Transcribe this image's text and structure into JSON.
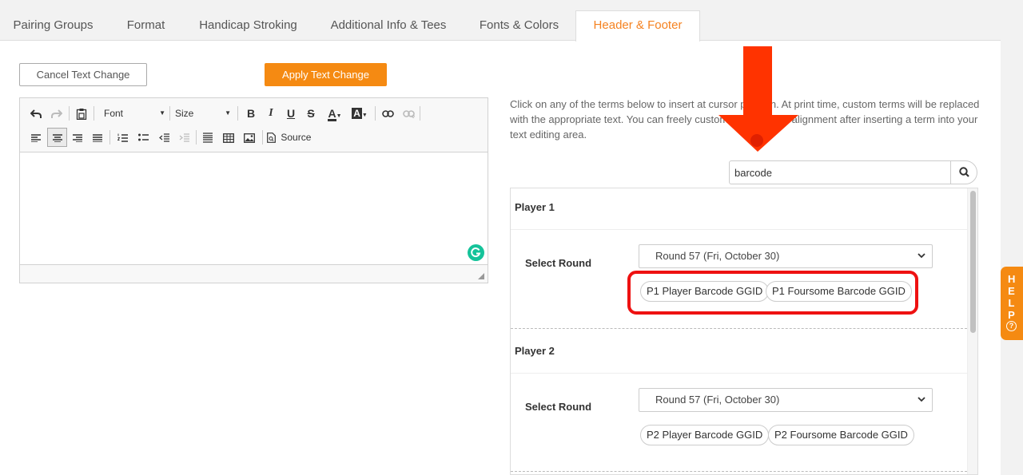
{
  "tabs": [
    {
      "label": "Pairing Groups"
    },
    {
      "label": "Format"
    },
    {
      "label": "Handicap Stroking"
    },
    {
      "label": "Additional Info & Tees"
    },
    {
      "label": "Fonts & Colors"
    },
    {
      "label": "Header & Footer",
      "active": true
    }
  ],
  "buttons": {
    "cancel_label": "Cancel Text Change",
    "apply_label": "Apply Text Change"
  },
  "toolbar": {
    "font_label": "Font",
    "size_label": "Size",
    "source_label": "Source"
  },
  "instructions": "Click on any of the terms below to insert at cursor position. At print time, custom terms will be replaced with the appropriate text. You can freely customize font, size, alignment after inserting a term into your text editing area.",
  "search": {
    "value": "barcode"
  },
  "players": [
    {
      "title": "Player 1",
      "select_label": "Select Round",
      "round_value": "Round 57 (Fri, October 30)",
      "chips": [
        "P1 Player Barcode GGID",
        "P1 Foursome Barcode GGID"
      ]
    },
    {
      "title": "Player 2",
      "select_label": "Select Round",
      "round_value": "Round 57 (Fri, October 30)",
      "chips": [
        "P2 Player Barcode GGID",
        "P2 Foursome Barcode GGID"
      ]
    }
  ],
  "help": {
    "label": "HELP",
    "question_mark": "?"
  },
  "colors": {
    "accent": "#f58a12",
    "active_tab_text": "#f58220",
    "highlight": "#ee1111",
    "arrow": "#ff3300",
    "grammarly": "#15c39a"
  }
}
